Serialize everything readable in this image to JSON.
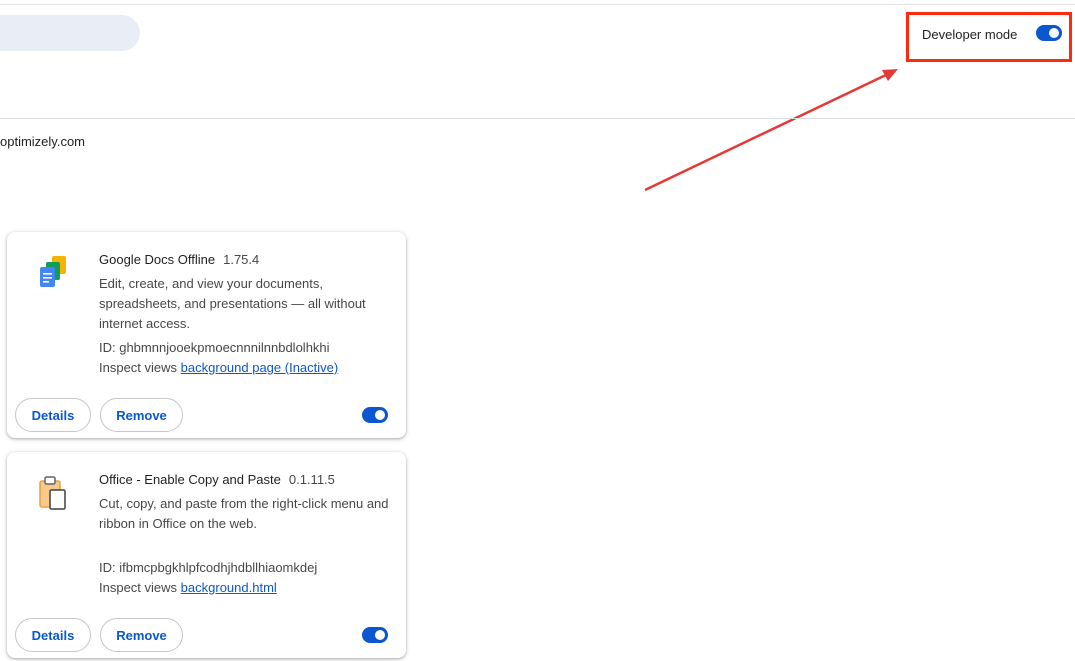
{
  "header": {
    "developer_mode_label": "Developer mode",
    "developer_mode_on": true
  },
  "source_text": "optimizely.com",
  "extensions": [
    {
      "name": "Google Docs Offline",
      "version": "1.75.4",
      "description": "Edit, create, and view your documents, spreadsheets, and presentations — all without internet access.",
      "id_text": "ID: ghbmnnjooekpmoecnnnilnnbdlolhkhi",
      "inspect_label": "Inspect views",
      "inspect_link": "background page (Inactive)",
      "details_label": "Details",
      "remove_label": "Remove",
      "enabled": true,
      "icon": "google-docs-icon"
    },
    {
      "name": "Office - Enable Copy and Paste",
      "version": "0.1.11.5",
      "description": "Cut, copy, and paste from the right-click menu and ribbon in Office on the web.",
      "id_text": "ID: ifbmcpbgkhlpfcodhjhdbllhiaomkdej",
      "inspect_label": "Inspect views",
      "inspect_link": "background.html",
      "details_label": "Details",
      "remove_label": "Remove",
      "enabled": true,
      "icon": "clipboard-icon"
    }
  ],
  "annotation": {
    "color": "#e53935",
    "box_color": "#ff2a0e"
  },
  "colors": {
    "accent": "#0b57d0",
    "search_bg": "#e9eef6"
  }
}
